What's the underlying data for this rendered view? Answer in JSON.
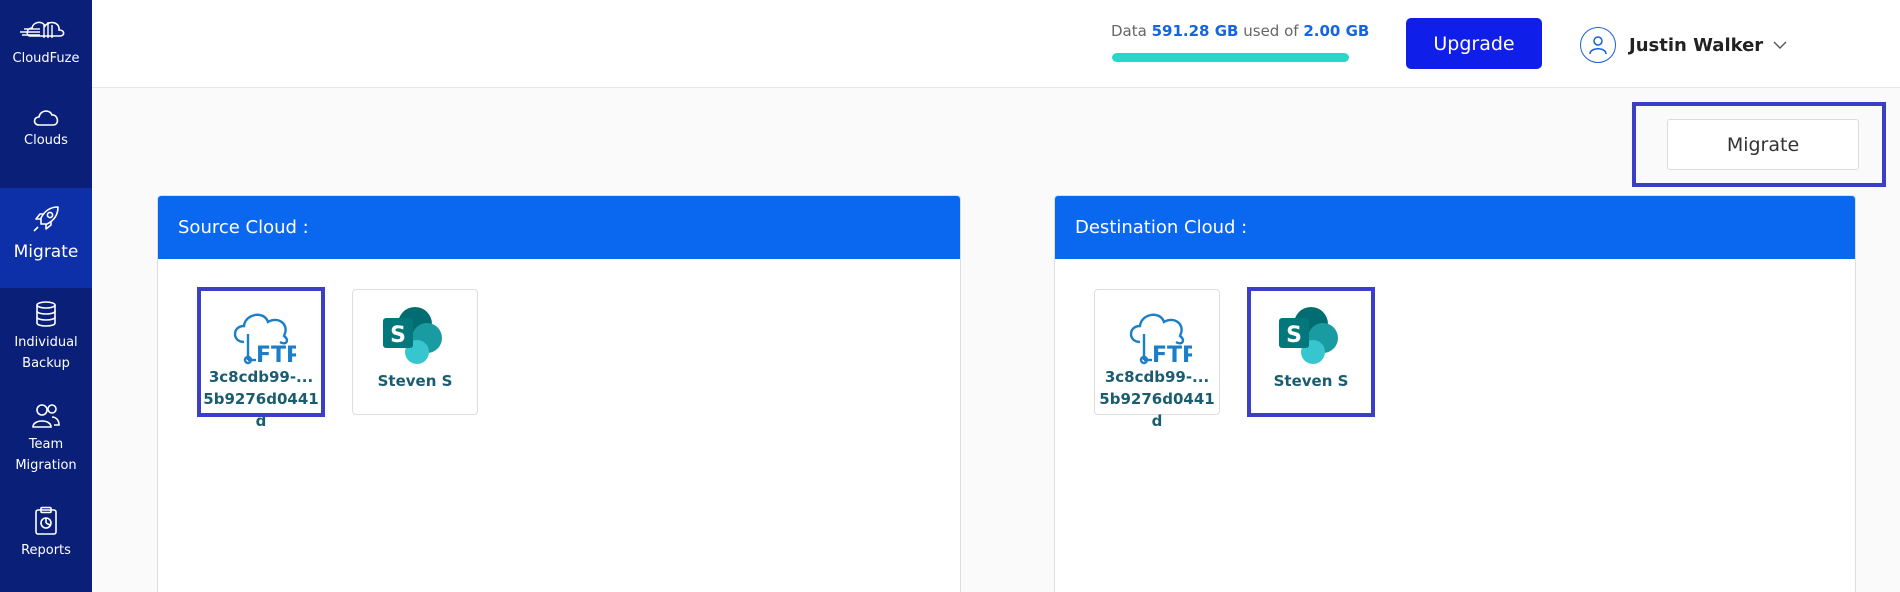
{
  "sidebar": {
    "brand": "CloudFuze",
    "items": [
      {
        "label": "Clouds",
        "icon": "cloud-icon"
      },
      {
        "label": "Migrate",
        "icon": "rocket-icon",
        "active": true
      },
      {
        "label": "Individual Backup",
        "line1": "Individual",
        "line2": "Backup",
        "icon": "database-icon"
      },
      {
        "label": "Team Migration",
        "line1": "Team",
        "line2": "Migration",
        "icon": "users-icon"
      },
      {
        "label": "Reports",
        "icon": "clipboard-icon"
      }
    ]
  },
  "header": {
    "usage": {
      "prefix": "Data",
      "used": "591.28 GB",
      "middle": "used of",
      "total": "2.00 GB",
      "fill_percent": 100
    },
    "upgrade_label": "Upgrade",
    "user_name": "Justin Walker"
  },
  "toolbar": {
    "migrate_label": "Migrate"
  },
  "source_panel": {
    "title": "Source Cloud :",
    "clouds": [
      {
        "name": "3c8cdb99-... 5b9276d0441d",
        "type": "ftp",
        "selected": true
      },
      {
        "name": "Steven S",
        "type": "sharepoint",
        "selected": false
      }
    ]
  },
  "destination_panel": {
    "title": "Destination Cloud :",
    "clouds": [
      {
        "name": "3c8cdb99-... 5b9276d0441d",
        "type": "ftp",
        "selected": false
      },
      {
        "name": "Steven S",
        "type": "sharepoint",
        "selected": true
      }
    ]
  },
  "colors": {
    "sidebar": "#0a1f78",
    "sidebar_active": "#0d2fa8",
    "panel_header": "#0a67f0",
    "upgrade_button": "#0f1ee8",
    "usage_bar": "#2ad6c8",
    "selection_frame": "#3b3fc8",
    "accent_text": "#1565e0"
  }
}
